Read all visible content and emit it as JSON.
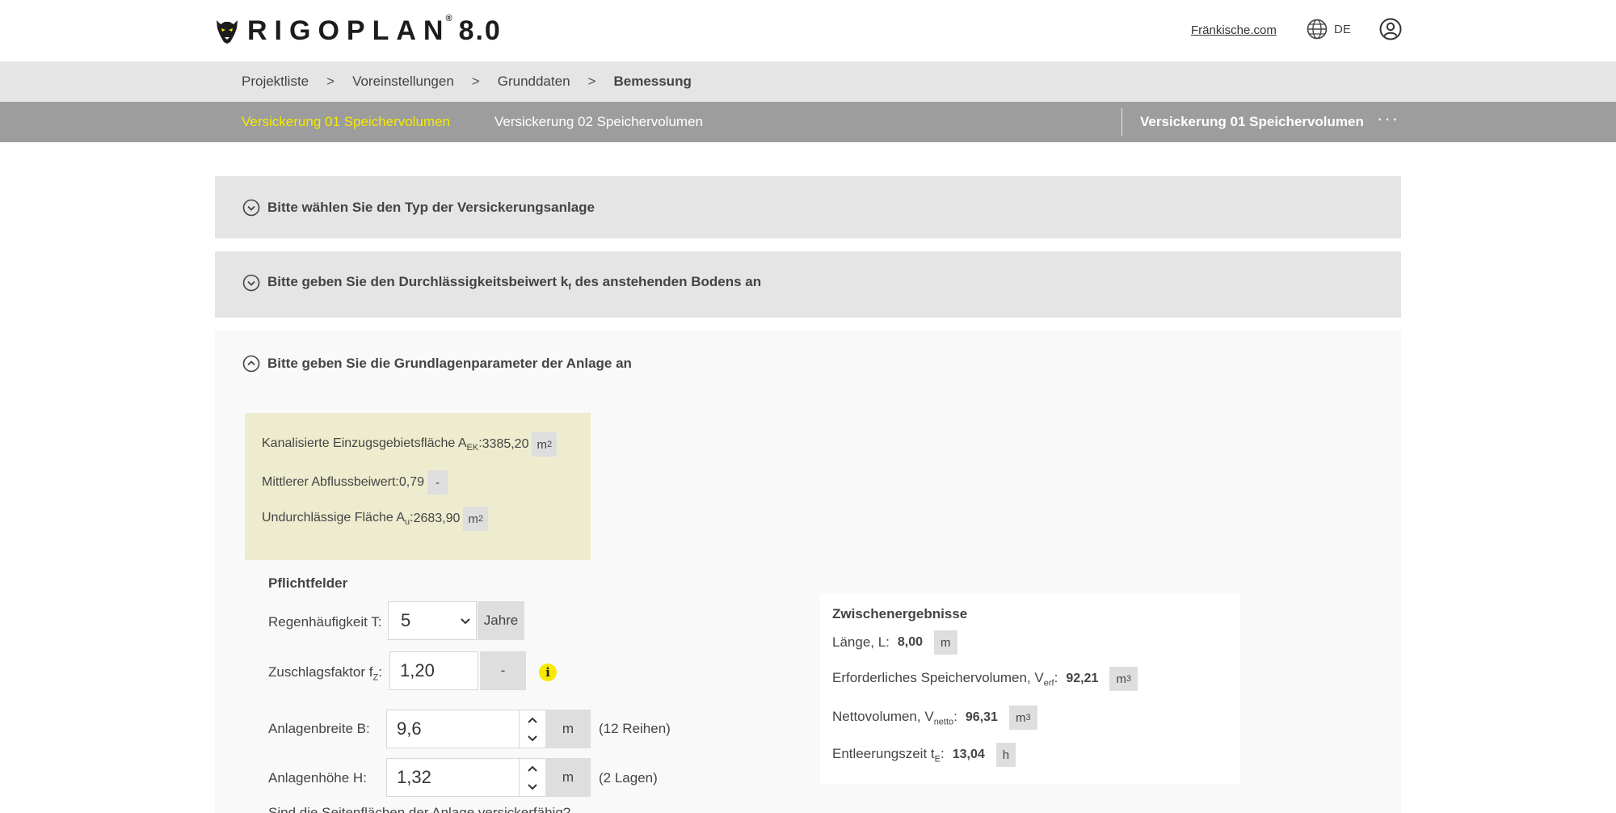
{
  "header": {
    "brand_name": "RIGOPLAN",
    "brand_reg": "®",
    "brand_version": "8.0",
    "external_link": "Fränkische.com",
    "language": "DE",
    "icons": [
      "panther-logo-icon",
      "globe-icon",
      "user-icon"
    ]
  },
  "breadcrumb": [
    "Projektliste",
    "Voreinstellungen",
    "Grunddaten",
    "Bemessung"
  ],
  "breadcrumb_separator": ">",
  "tabs": {
    "items": [
      {
        "label": "Versickerung 01 Speichervolumen",
        "active": true
      },
      {
        "label": "Versickerung 02 Speichervolumen",
        "active": false
      }
    ],
    "current_title": "Versickerung 01 Speichervolumen",
    "more": "···"
  },
  "sections": {
    "type": {
      "title": "Bitte wählen Sie den Typ der Versickerungsanlage",
      "expanded": false
    },
    "kf": {
      "title_pre": "Bitte geben Sie den Durchlässigkeitsbeiwert k",
      "title_sub": "f",
      "title_post": " des anstehenden Bodens an",
      "expanded": false
    },
    "params": {
      "title": "Bitte geben Sie die Grundlagenparameter der Anlage an",
      "expanded": true
    }
  },
  "infobox": {
    "area": {
      "label_pre": "Kanalisierte Einzugsgebietsfläche A",
      "label_sub": "EK",
      "label_post": ": ",
      "value": "3385,20",
      "unit_base": "m",
      "unit_sup": "2"
    },
    "runoff": {
      "label": "Mittlerer Abflussbeiwert: ",
      "value": "0,79",
      "unit": "-"
    },
    "impervious": {
      "label_pre": "Undurchlässige Fläche A",
      "label_sub": "u",
      "label_post": ": ",
      "value": "2683,90",
      "unit_base": "m",
      "unit_sup": "2"
    }
  },
  "form": {
    "section_label": "Pflichtfelder",
    "rain": {
      "label": "Regenhäufigkeit T:",
      "value": "5",
      "unit": "Jahre"
    },
    "factor": {
      "label_pre": "Zuschlagsfaktor f",
      "label_sub": "Z",
      "label_post": ":",
      "value": "1,20",
      "unit": "-",
      "info": "i"
    },
    "width": {
      "label": "Anlagenbreite B:",
      "value": "9,6",
      "unit": "m",
      "hint": "(12 Reihen)"
    },
    "height": {
      "label": "Anlagenhöhe H:",
      "value": "1,32",
      "unit": "m",
      "hint": "(2 Lagen)"
    },
    "question": "Sind die Seitenflächen der Anlage versickerfähig?"
  },
  "results": {
    "title": "Zwischenergebnisse",
    "length": {
      "label": "Länge, L:",
      "value": "8,00",
      "unit": "m"
    },
    "volume": {
      "label_pre": "Erforderliches Speichervolumen, V",
      "label_sub": "erf",
      "label_post": ":",
      "value": "92,21",
      "unit_base": "m",
      "unit_sup": "3"
    },
    "net": {
      "label_pre": "Nettovolumen, V",
      "label_sub": "netto",
      "label_post": ":",
      "value": "96,31",
      "unit_base": "m",
      "unit_sup": "3"
    },
    "emptying": {
      "label_pre": "Entleerungszeit t",
      "label_sub": "E",
      "label_post": ":",
      "value": "13,04",
      "unit": "h"
    }
  },
  "colors": {
    "accent_yellow": "#f5ea00",
    "tab_bar": "#9d9d9d",
    "breadcrumb_bg": "#e5e5e5",
    "infobox_bg": "#eeecce"
  }
}
